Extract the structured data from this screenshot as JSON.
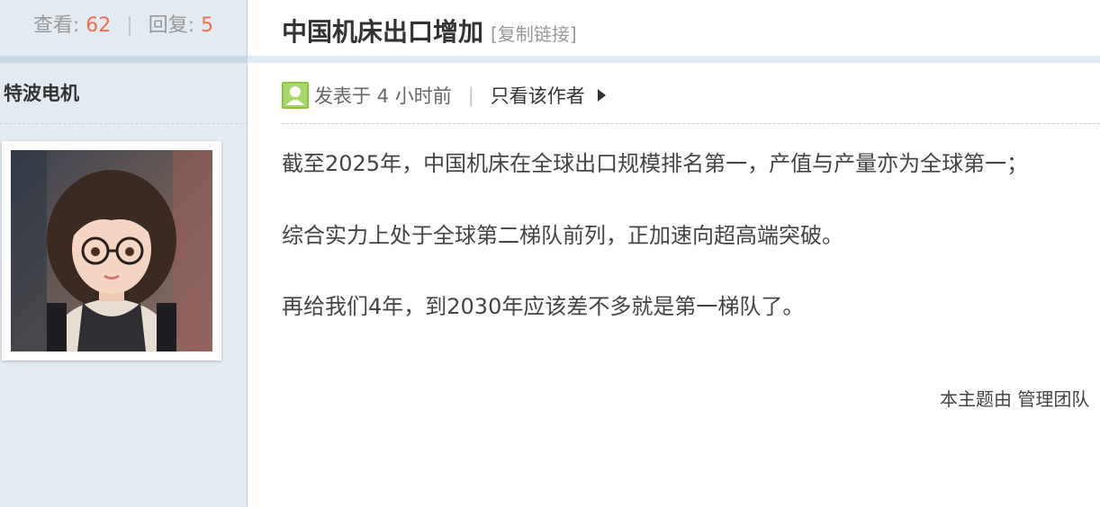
{
  "stats": {
    "views_label": "查看:",
    "views_count": "62",
    "separator": "|",
    "replies_label": "回复:",
    "replies_count": "5"
  },
  "author": {
    "name": "特波电机"
  },
  "thread": {
    "title": "中国机床出口增加",
    "copy_link": "[复制链接]"
  },
  "post_meta": {
    "posted": "发表于 4 小时前",
    "separator": "|",
    "only_author": "只看该作者"
  },
  "post_content": {
    "paragraphs": [
      "截至2025年，中国机床在全球出口规模排名第一，产值与产量亦为全球第一；",
      "综合实力上处于全球第二梯队前列，正加速向超高端突破。",
      "再给我们4年，到2030年应该差不多就是第一梯队了。"
    ]
  },
  "footer_note": "本主题由 管理团队",
  "colors": {
    "sidebar_bg": "#e3ebf2",
    "accent_number": "#f26c4f",
    "user_icon": "#8cc63f"
  },
  "icons": {
    "user": "user-icon",
    "arrow": "triangle-right-icon"
  }
}
